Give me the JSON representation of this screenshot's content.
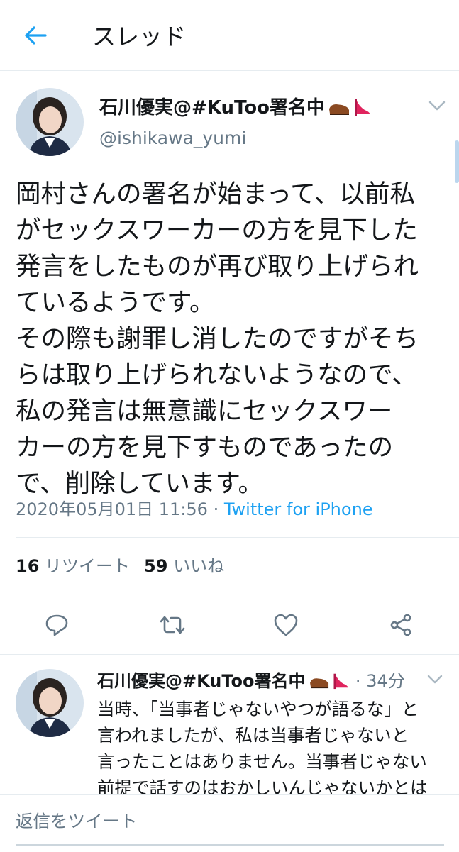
{
  "header": {
    "title": "スレッド"
  },
  "main_tweet": {
    "author_name": "石川優実@#KuToo署名中",
    "author_handle": "@ishikawa_yumi",
    "body_lines": [
      "岡村さんの署名が始まって、以前私",
      "がセックスワーカーの方を見下した",
      "発言をしたものが再び取り上げられ",
      "ているようです。",
      "その際も謝罪し消したのですがそち",
      "らは取り上げられないようなので、",
      "私の発言は無意識にセックスワー",
      "カーの方を見下すものであったの",
      "で、削除しています。"
    ],
    "datetime": "2020年05月01日 11:56",
    "separator": " · ",
    "source": "Twitter for iPhone",
    "retweet_count": "16",
    "retweet_label": "リツイート",
    "like_count": "59",
    "like_label": "いいね"
  },
  "actions": [
    "reply-icon",
    "retweet-icon",
    "heart-icon",
    "share-icon"
  ],
  "reply_tweet": {
    "author_name": "石川優実@#KuToo署名中",
    "time": "· 34分",
    "body_lines": [
      "当時、「当事者じゃないやつが語るな」と",
      "言われましたが、私は当事者じゃないと",
      "言ったことはありません。当事者じゃない",
      "前提で話すのはおかしいんじゃないかとは"
    ]
  },
  "composer": {
    "placeholder": "返信をツイート"
  },
  "colors": {
    "accent": "#1da1f2",
    "secondary_text": "#657786",
    "divider": "#e6ecf0"
  }
}
